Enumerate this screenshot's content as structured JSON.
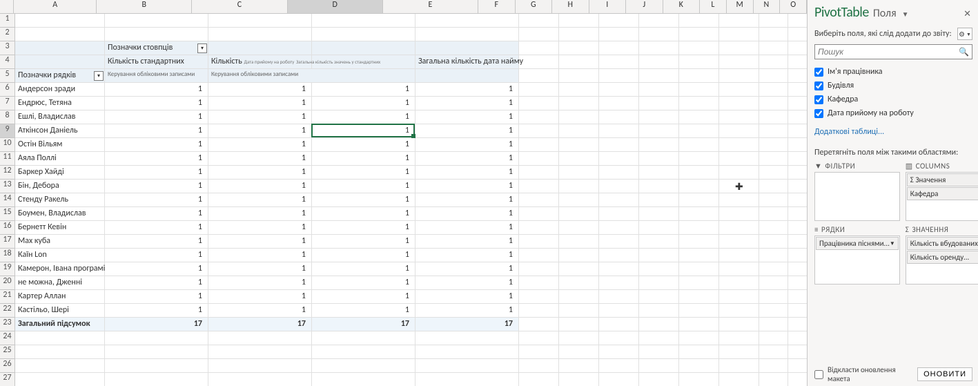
{
  "grid": {
    "col_widths": {
      "A": 130,
      "B": 150,
      "C": 150,
      "D": 150,
      "E": 150,
      "F": 58,
      "G": 58,
      "H": 58,
      "I": 58,
      "J": 58,
      "K": 58,
      "L": 42,
      "M": 42,
      "N": 42,
      "O": 42
    },
    "row_count": 27,
    "pivot_header_fill_rows": [
      3,
      4,
      5
    ],
    "selected_cell": "D9",
    "hover_cursor_cell": "K13"
  },
  "pivot_table_cells": {
    "col_labels_title": "Позначки стовпців",
    "row_labels_title": "Позначки рядків",
    "hdr_b4": "Кількість стандартних",
    "hdr_c4": "Кількість",
    "hdr_c4_tiny1": "Дата прийому на роботу",
    "hdr_c4_tiny2": "Загальна кількість значень у стандартних",
    "hdr_e4": "Загальна кількість дата найму",
    "hdr_b5": "Керування обліковими записами",
    "hdr_c5": "Керування обліковими записами",
    "total_label": "Загальний підсумок"
  },
  "pivot_rows": [
    {
      "name": "Андерсон зради",
      "vals": [
        1,
        1,
        1,
        1
      ]
    },
    {
      "name": "Ендрюс, Тетяна",
      "vals": [
        1,
        1,
        1,
        1
      ]
    },
    {
      "name": "Ешлі, Владислав",
      "vals": [
        1,
        1,
        1,
        1
      ]
    },
    {
      "name": "Аткінсон Даніель",
      "vals": [
        1,
        1,
        1,
        1
      ]
    },
    {
      "name": "Остін Вільям",
      "vals": [
        1,
        1,
        1,
        1
      ]
    },
    {
      "name": "Аяла Поллі",
      "vals": [
        1,
        1,
        1,
        1
      ]
    },
    {
      "name": "Баркер Хайді",
      "vals": [
        1,
        1,
        1,
        1
      ]
    },
    {
      "name": "Бін, Дебора",
      "vals": [
        1,
        1,
        1,
        1
      ]
    },
    {
      "name": "Стенду Ракель",
      "vals": [
        1,
        1,
        1,
        1
      ]
    },
    {
      "name": "Боумен, Владислав",
      "vals": [
        1,
        1,
        1,
        1
      ]
    },
    {
      "name": "Бернетт Кевін",
      "vals": [
        1,
        1,
        1,
        1
      ]
    },
    {
      "name": "Мах куба",
      "vals": [
        1,
        1,
        1,
        1
      ]
    },
    {
      "name": "Каїн Lon",
      "vals": [
        1,
        1,
        1,
        1
      ]
    },
    {
      "name": "Камерон, Івана програмі",
      "vals": [
        1,
        1,
        1,
        1
      ]
    },
    {
      "name": "не можна, Дженні",
      "vals": [
        1,
        1,
        1,
        1
      ]
    },
    {
      "name": "Картер Аллан",
      "vals": [
        1,
        1,
        1,
        1
      ]
    },
    {
      "name": "Кастільо, Шері",
      "vals": [
        1,
        1,
        1,
        1
      ]
    }
  ],
  "pivot_totals": [
    17,
    17,
    17,
    17
  ],
  "panel": {
    "title": "PivotTable",
    "subtitle": "Поля",
    "choose_fields": "Виберіть поля, які слід додати до звіту:",
    "search_placeholder": "Пошук",
    "fields": [
      {
        "label": "Ім'я працівника",
        "checked": true
      },
      {
        "label": "Будівля",
        "checked": true
      },
      {
        "label": "Кафедра",
        "checked": true
      },
      {
        "label": "Дата прийому на роботу",
        "checked": true
      }
    ],
    "more_tables": "Додаткові таблиці...",
    "drag_desc": "Перетягніть поля між такими областями:",
    "areas": {
      "filters_label": "ФІЛЬТРИ",
      "columns_label": "COLUMNS",
      "rows_label": "РЯДКИ",
      "values_label": "ЗНАЧЕННЯ",
      "columns_items": [
        "Σ Значення",
        "Кафедра"
      ],
      "rows_items": [
        "Працівника піснями..."
      ],
      "values_items": [
        "Кількість вбудованих...",
        "Кількість оренду..."
      ]
    },
    "defer_label": "Відкласти оновлення макета",
    "update_btn": "ОНОВИТИ"
  }
}
